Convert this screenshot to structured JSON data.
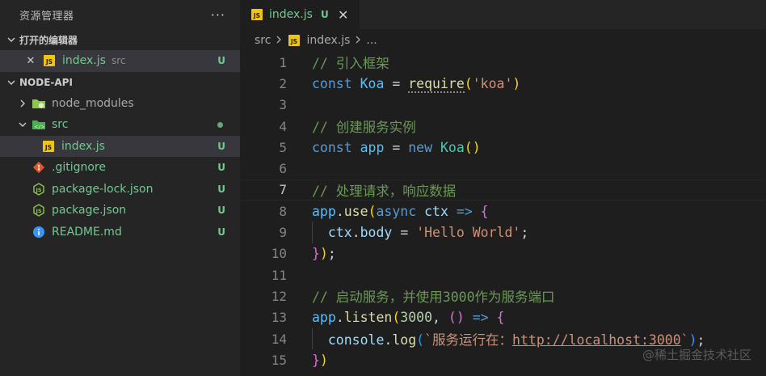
{
  "sidebar": {
    "title": "资源管理器",
    "more": "···",
    "open_editors": {
      "title": "打开的编辑器",
      "items": [
        {
          "name": "index.js",
          "desc": "src",
          "status": "U",
          "close": "✕"
        }
      ]
    },
    "project": {
      "title": "NODE-API",
      "items": [
        {
          "name": "node_modules",
          "status": ""
        },
        {
          "name": "src",
          "status": ""
        },
        {
          "name": "index.js",
          "status": "U"
        },
        {
          "name": ".gitignore",
          "status": "U"
        },
        {
          "name": "package-lock.json",
          "status": "U"
        },
        {
          "name": "package.json",
          "status": "U"
        },
        {
          "name": "README.md",
          "status": "U"
        }
      ]
    }
  },
  "tab": {
    "label": "index.js",
    "status": "U",
    "close": "✕"
  },
  "breadcrumbs": {
    "folder": "src",
    "file": "index.js",
    "tail": "..."
  },
  "code": {
    "line_numbers": [
      "1",
      "2",
      "3",
      "4",
      "5",
      "6",
      "7",
      "8",
      "9",
      "10",
      "11",
      "12",
      "13",
      "14",
      "15"
    ],
    "active_line": 7,
    "tokens": {
      "l1_comment": "// 引入框架",
      "l2_const": "const",
      "l2_var": "Koa",
      "l2_eq": "=",
      "l2_fn": "require",
      "l2_open": "(",
      "l2_str": "'koa'",
      "l2_close": ")",
      "l4_comment": "// 创建服务实例",
      "l5_const": "const",
      "l5_var": "app",
      "l5_eq": "=",
      "l5_new": "new",
      "l5_cls": "Koa",
      "l5_parens": "()",
      "l7_comment": "// 处理请求，响应数据",
      "l8_obj": "app",
      "l8_dot": ".",
      "l8_fn": "use",
      "l8_open": "(",
      "l8_async": "async",
      "l8_param": "ctx",
      "l8_arrow": "=>",
      "l8_brace": "{",
      "l9_obj": "ctx",
      "l9_dot": ".",
      "l9_prop": "body",
      "l9_eq": "=",
      "l9_str": "'Hello World'",
      "l9_semi": ";",
      "l10_brace": "}",
      "l10_paren": ")",
      "l10_semi": ";",
      "l12_comment": "// 启动服务，并使用3000作为服务端口",
      "l13_obj": "app",
      "l13_dot": ".",
      "l13_fn": "listen",
      "l13_open": "(",
      "l13_num": "3000",
      "l13_comma": ",",
      "l13_parens": "()",
      "l13_arrow": "=>",
      "l13_brace": "{",
      "l14_obj": "console",
      "l14_dot": ".",
      "l14_fn": "log",
      "l14_open": "(",
      "l14_str_a": "`服务运行在：",
      "l14_url": "http://localhost:3000",
      "l14_str_b": "`",
      "l14_close": ")",
      "l14_semi": ";",
      "l15_brace": "}",
      "l15_paren": ")"
    }
  },
  "watermark": "@稀土掘金技术社区",
  "colors": {
    "sidebar_bg": "#252526",
    "editor_bg": "#1e1e1e",
    "git_untracked": "#73c991",
    "js_icon": "#f1c40f",
    "git_icon": "#e8512a",
    "node_icon": "#8cc84b",
    "info_icon": "#3794ff"
  }
}
